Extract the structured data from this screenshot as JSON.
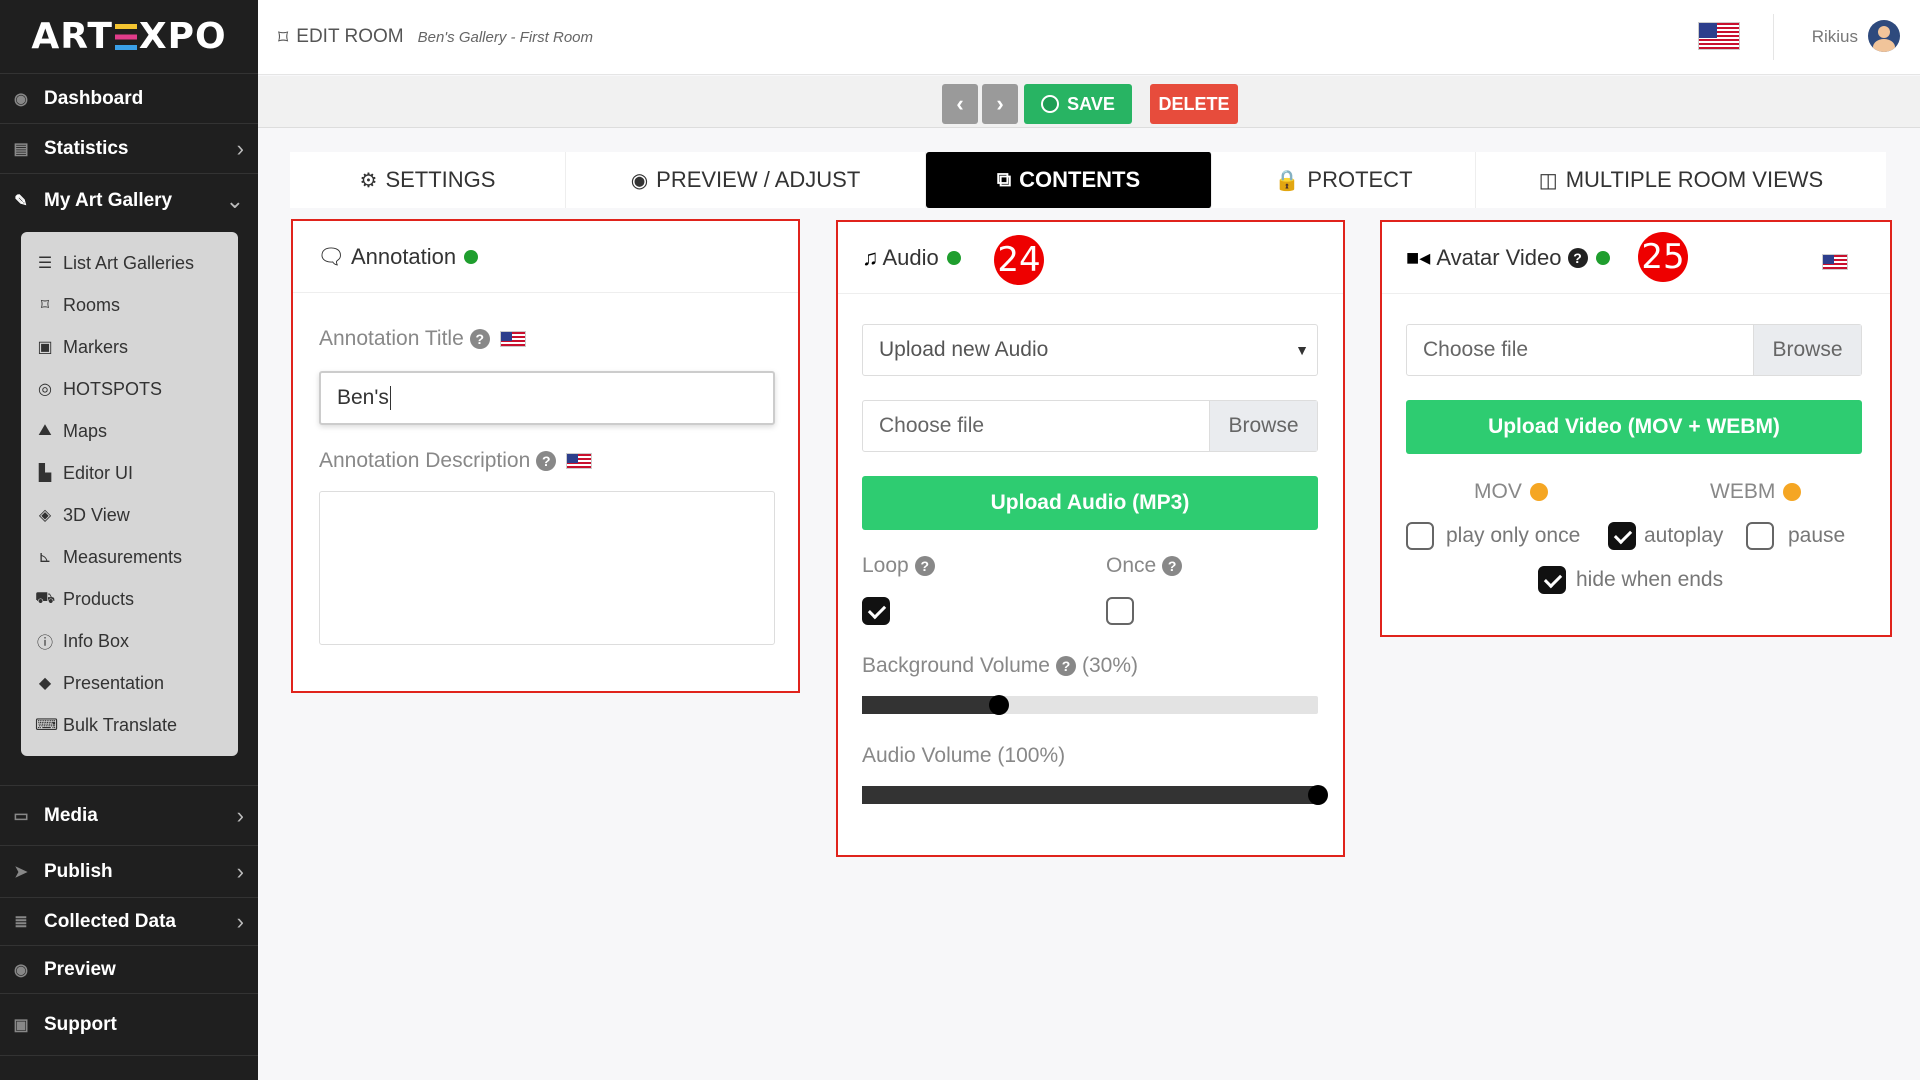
{
  "app": {
    "logo_text_left": "ART",
    "logo_text_right": "XPO"
  },
  "sidebar": {
    "items_top": [
      {
        "label": "Dashboard",
        "icon": "dashboard-icon"
      },
      {
        "label": "Statistics",
        "icon": "chart-icon"
      },
      {
        "label": "My Art Gallery",
        "icon": "palette-icon"
      }
    ],
    "submenu": [
      {
        "label": "List Art Galleries",
        "icon": "list-icon"
      },
      {
        "label": "Rooms",
        "icon": "room-icon"
      },
      {
        "label": "Markers",
        "icon": "marker-icon"
      },
      {
        "label": "HOTSPOTS",
        "icon": "target-icon"
      },
      {
        "label": "Maps",
        "icon": "map-icon"
      },
      {
        "label": "Editor UI",
        "icon": "editor-icon"
      },
      {
        "label": "3D View",
        "icon": "cube-icon"
      },
      {
        "label": "Measurements",
        "icon": "ruler-icon"
      },
      {
        "label": "Products",
        "icon": "cart-icon"
      },
      {
        "label": "Info Box",
        "icon": "info-icon"
      },
      {
        "label": "Presentation",
        "icon": "presentation-icon"
      },
      {
        "label": "Bulk Translate",
        "icon": "translate-icon"
      }
    ],
    "items_bottom": [
      {
        "label": "Media",
        "icon": "monitor-icon"
      },
      {
        "label": "Publish",
        "icon": "send-icon"
      },
      {
        "label": "Collected Data",
        "icon": "database-icon"
      },
      {
        "label": "Preview",
        "icon": "eye-icon"
      },
      {
        "label": "Support",
        "icon": "support-icon"
      }
    ]
  },
  "topbar": {
    "title": "EDIT ROOM",
    "breadcrumb": "Ben's Gallery - First Room",
    "user_name": "Rikius"
  },
  "actions": {
    "prev": "‹",
    "next": "›",
    "save": "SAVE",
    "delete": "DELETE"
  },
  "tabs": [
    {
      "label": "SETTINGS",
      "icon": "gears-icon"
    },
    {
      "label": "PREVIEW / ADJUST",
      "icon": "eye-icon"
    },
    {
      "label": "CONTENTS",
      "icon": "images-icon",
      "active": true
    },
    {
      "label": "PROTECT",
      "icon": "lock-icon"
    },
    {
      "label": "MULTIPLE ROOM VIEWS",
      "icon": "columns-icon"
    }
  ],
  "annotation": {
    "heading": "Annotation",
    "title_label": "Annotation Title",
    "title_value": "Ben's",
    "description_label": "Annotation Description",
    "description_value": ""
  },
  "audio": {
    "heading": "Audio",
    "badge": "24",
    "select_value": "Upload new Audio",
    "file_placeholder": "Choose file",
    "browse": "Browse",
    "upload_button": "Upload Audio (MP3)",
    "loop_label": "Loop",
    "loop_checked": true,
    "once_label": "Once",
    "once_checked": false,
    "bg_volume_label": "Background Volume",
    "bg_volume_text": "(30%)",
    "bg_volume": 0.3,
    "audio_volume_label": "Audio Volume (100%)",
    "audio_volume": 1.0
  },
  "avatar_video": {
    "heading": "Avatar Video",
    "badge": "25",
    "file_placeholder": "Choose file",
    "browse": "Browse",
    "upload_button": "Upload Video (MOV + WEBM)",
    "mov_label": "MOV",
    "webm_label": "WEBM",
    "play_only_once_label": "play only once",
    "play_only_once": false,
    "autoplay_label": "autoplay",
    "autoplay": true,
    "pause_label": "pause",
    "pause": false,
    "hide_when_ends_label": "hide when ends",
    "hide_when_ends": true
  }
}
